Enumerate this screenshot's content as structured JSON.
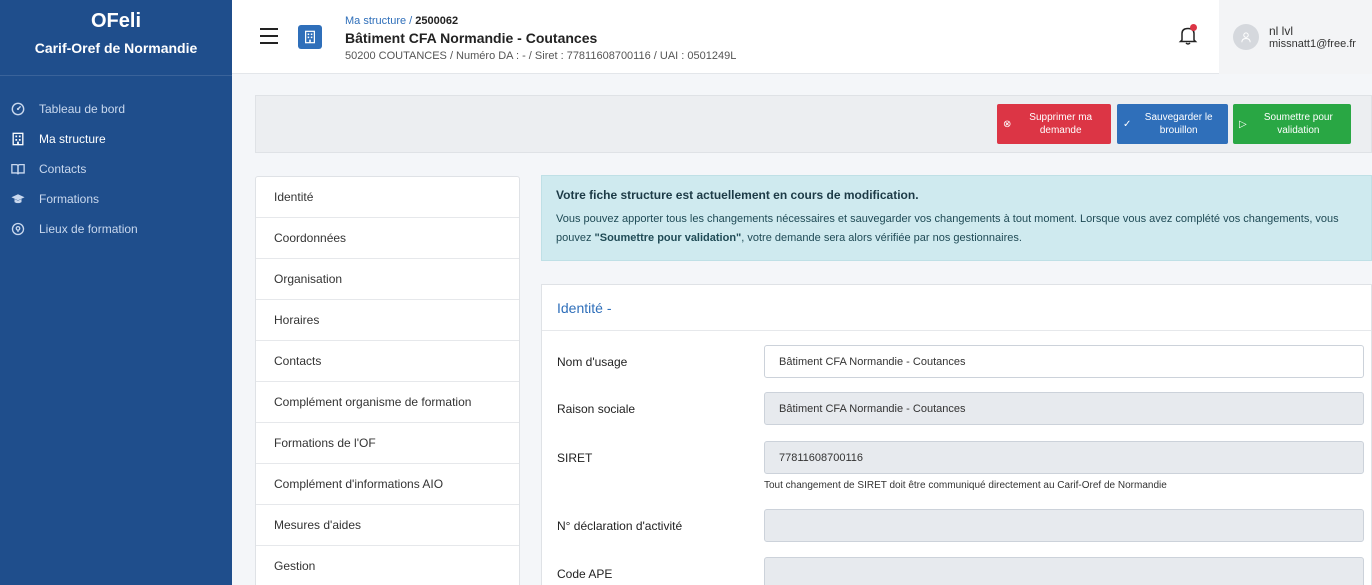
{
  "brand": {
    "title": "OFeli",
    "subtitle": "Carif-Oref de Normandie"
  },
  "sidebar": {
    "items": [
      {
        "label": "Tableau de bord",
        "icon": "dashboard-icon",
        "active": false
      },
      {
        "label": "Ma structure",
        "icon": "building-icon",
        "active": true
      },
      {
        "label": "Contacts",
        "icon": "book-icon",
        "active": false
      },
      {
        "label": "Formations",
        "icon": "graduation-cap-icon",
        "active": false
      },
      {
        "label": "Lieux de formation",
        "icon": "location-icon",
        "active": false
      }
    ]
  },
  "header": {
    "breadcrumb_prefix": "Ma structure / ",
    "breadcrumb_id": "2500062",
    "title": "Bâtiment CFA Normandie - Coutances",
    "subtitle": "50200 COUTANCES / Numéro DA : - / Siret : 77811608700116 / UAI : 0501249L",
    "user_name": "nl lvl",
    "user_email": "missnatt1@free.fr"
  },
  "actions": {
    "delete_label": "Supprimer ma demande",
    "save_label": "Sauvegarder le brouillon",
    "submit_label": "Soumettre pour validation"
  },
  "tabs": [
    "Identité",
    "Coordonnées",
    "Organisation",
    "Horaires",
    "Contacts",
    "Complément organisme de formation",
    "Formations de l'OF",
    "Complément d'informations AIO",
    "Mesures d'aides",
    "Gestion"
  ],
  "alert": {
    "title": "Votre fiche structure est actuellement en cours de modification.",
    "body_part1": "Vous pouvez apporter tous les changements nécessaires et sauvegarder vos changements à tout moment. Lorsque vous avez complété vos changements, vous pouvez ",
    "body_bold": "\"Soumettre pour validation\"",
    "body_part2": ", votre demande sera alors vérifiée par nos gestionnaires."
  },
  "form": {
    "section_title": "Identité -",
    "nom_usage_label": "Nom d'usage",
    "nom_usage_value": "Bâtiment CFA Normandie - Coutances",
    "raison_sociale_label": "Raison sociale",
    "raison_sociale_value": "Bâtiment CFA Normandie - Coutances",
    "siret_label": "SIRET",
    "siret_value": "77811608700116",
    "siret_help": "Tout changement de SIRET doit être communiqué directement au Carif-Oref de Normandie",
    "nda_label": "N° déclaration d'activité",
    "nda_value": "",
    "ape_label": "Code APE",
    "ape_value": ""
  },
  "colors": {
    "sidebar_bg": "#1f4e8c",
    "primary": "#2f6fba",
    "danger": "#dc3545",
    "success": "#29a744",
    "alert_bg": "#cfeaef"
  }
}
